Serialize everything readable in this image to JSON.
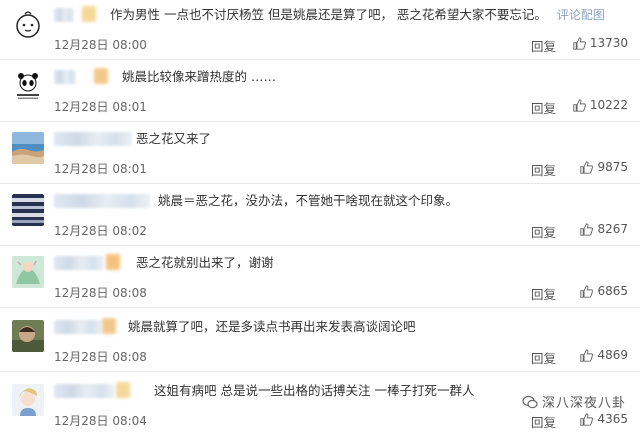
{
  "comments": [
    {
      "text": "作为男性 一点也不讨厌杨笠 但是姚晨还是算了吧， 恶之花希望大家不要忘记。",
      "more_link": "评论配图",
      "time": "12月28日 08:00",
      "reply": "回复",
      "likes": "13730",
      "avatar": "baby-face-avatar",
      "badge_color": "#f6d89a"
    },
    {
      "text": "姚晨比较像来蹭热度的 ……",
      "more_link": "",
      "time": "12月28日 08:01",
      "reply": "回复",
      "likes": "10222",
      "avatar": "panda-avatar",
      "badge_color": "#f3c98b"
    },
    {
      "text": "恶之花又来了",
      "more_link": "",
      "time": "12月28日 08:01",
      "reply": "回复",
      "likes": "9875",
      "avatar": "landscape-avatar",
      "badge_color": ""
    },
    {
      "text": "姚晨＝恶之花，没办法，不管她干啥现在就这个印象。",
      "more_link": "",
      "time": "12月28日 08:02",
      "reply": "回复",
      "likes": "8267",
      "avatar": "striped-avatar",
      "badge_color": ""
    },
    {
      "text": "恶之花就别出来了，谢谢",
      "more_link": "",
      "time": "12月28日 08:08",
      "reply": "回复",
      "likes": "6865",
      "avatar": "green-illustration-avatar",
      "badge_color": "#f4c27c"
    },
    {
      "text": "姚晨就算了吧，还是多读点书再出来发表高谈阔论吧",
      "more_link": "",
      "time": "12月28日 08:08",
      "reply": "回复",
      "likes": "4869",
      "avatar": "photo-avatar",
      "badge_color": "#f1c98f"
    },
    {
      "text": "这姐有病吧 总是说一些出格的话搏关注 一棒子打死一群人",
      "more_link": "",
      "time": "12月28日 08:04",
      "reply": "回复",
      "likes": "4365",
      "avatar": "anime-avatar",
      "badge_color": "#f6d89a"
    }
  ],
  "watermark": "深八深夜八卦",
  "colors": {
    "link": "#8aa2c2",
    "divider": "#e8e8e8"
  }
}
